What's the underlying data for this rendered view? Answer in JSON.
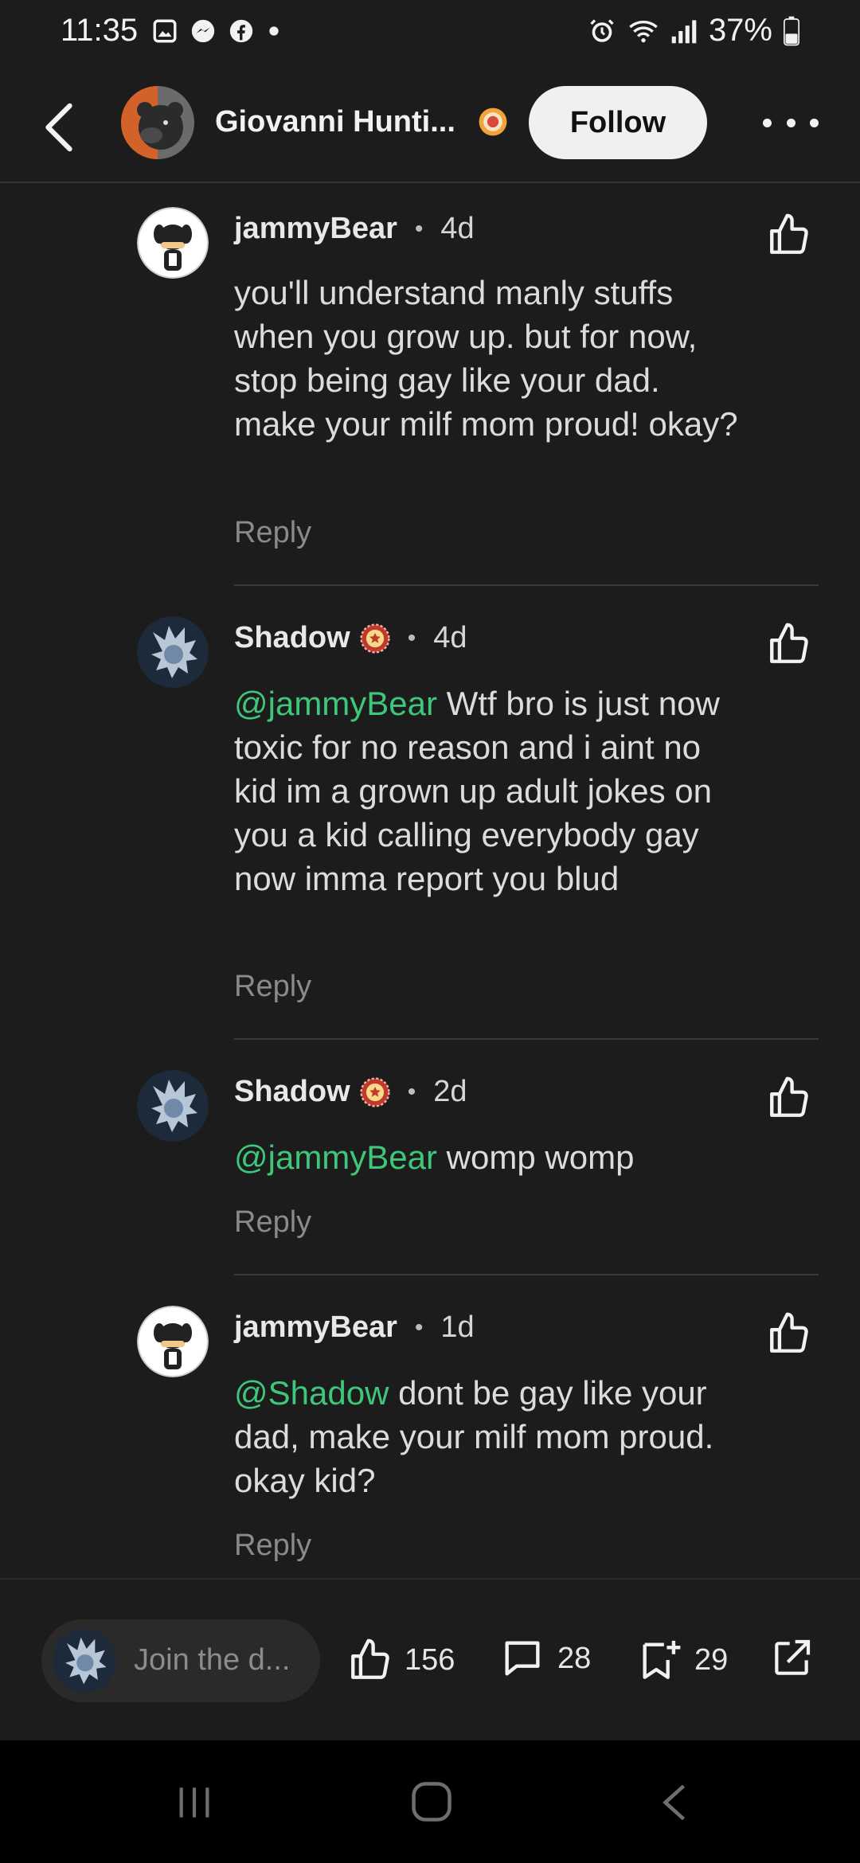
{
  "status_bar": {
    "time": "11:35",
    "battery": "37%"
  },
  "header": {
    "title": "Giovanni Hunti...",
    "follow_label": "Follow"
  },
  "comments": [
    {
      "user": "jammyBear",
      "age": "4d",
      "mention": "",
      "text": "you'll understand manly stuffs when you grow up. but for now, stop being gay like your dad. make your milf mom proud! okay?",
      "reply_label": "Reply"
    },
    {
      "user": "Shadow",
      "age": "4d",
      "mention": "@jammyBear",
      "text": " Wtf bro is just now toxic for no reason and i aint no kid im a grown up adult jokes on you a kid calling everybody gay now imma report you blud",
      "reply_label": "Reply"
    },
    {
      "user": "Shadow",
      "age": "2d",
      "mention": "@jammyBear",
      "text": " womp womp",
      "reply_label": "Reply"
    },
    {
      "user": "jammyBear",
      "age": "1d",
      "mention": "@Shadow",
      "text": " dont be gay like your dad, make your milf mom proud. okay kid?",
      "reply_label": "Reply"
    }
  ],
  "separator": "•",
  "bottom_bar": {
    "join_placeholder": "Join the d...",
    "likes": "156",
    "comments": "28",
    "saves": "29"
  },
  "colors": {
    "background": "#1c1c1c",
    "mention": "#3ec77a",
    "follow_bg": "#f0f0f0"
  }
}
